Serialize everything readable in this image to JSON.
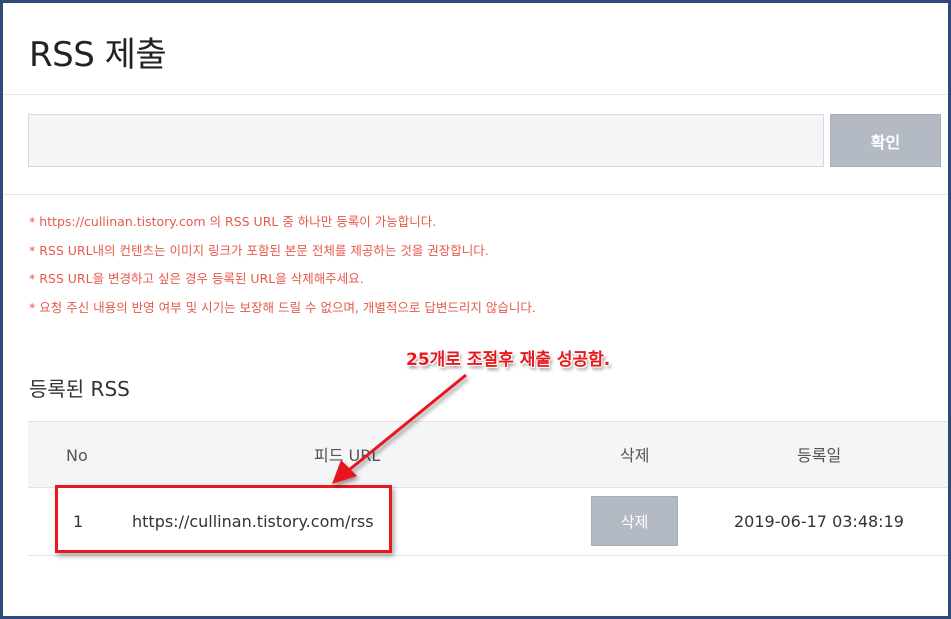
{
  "page": {
    "title": "RSS 제출"
  },
  "form": {
    "input_value": "",
    "input_placeholder": "",
    "confirm_label": "확인"
  },
  "notices": [
    "* https://cullinan.tistory.com 의 RSS URL 중 하나만 등록이 가능합니다.",
    "* RSS URL내의 컨텐츠는 이미지 링크가 포함된 본문 전체를 제공하는 것을 권장합니다.",
    "* RSS URL을 변경하고 싶은 경우 등록된 URL을 삭제해주세요.",
    "* 요청 주신 내용의 반영 여부 및 시기는 보장해 드릴 수 없으며, 개별적으로 답변드리지 않습니다."
  ],
  "registered": {
    "title": "등록된 RSS",
    "columns": {
      "no": "No",
      "feed_url": "피드 URL",
      "delete": "삭제",
      "date": "등록일"
    },
    "rows": [
      {
        "no": "1",
        "feed_url": "https://cullinan.tistory.com/rss",
        "delete_label": "삭제",
        "date": "2019-06-17 03:48:19"
      }
    ]
  },
  "annotation": {
    "text": "25개로 조절후 재출 성공함.",
    "color": "#e8191c"
  },
  "colors": {
    "notice": "#e65a4b",
    "button_gray": "#b3bac3",
    "window_border": "#2e4a7a"
  }
}
